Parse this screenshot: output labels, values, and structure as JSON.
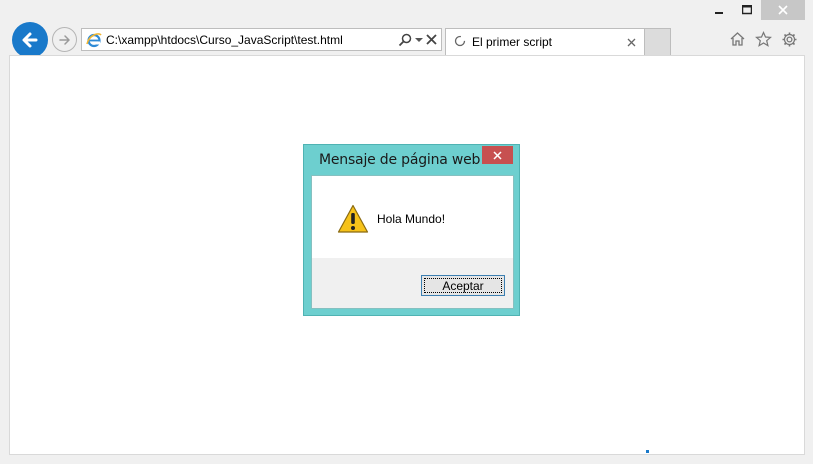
{
  "window": {
    "colors": {
      "accent": "#1979ca",
      "dialog_frame": "#6dcfcf",
      "dialog_close": "#c75050"
    }
  },
  "nav": {
    "back_icon": "back-arrow-icon",
    "forward_icon": "forward-arrow-icon"
  },
  "address": {
    "url": "C:\\xampp\\htdocs\\Curso_JavaScript\\test.html",
    "icons": [
      "search-icon",
      "dropdown-icon",
      "close-icon"
    ]
  },
  "tab": {
    "title": "El primer script"
  },
  "tools": [
    "home-icon",
    "favorites-star-icon",
    "settings-gear-icon"
  ],
  "dialog": {
    "title": "Mensaje de página web",
    "message": "Hola Mundo!",
    "icon": "warning-icon",
    "button_label": "Aceptar"
  }
}
